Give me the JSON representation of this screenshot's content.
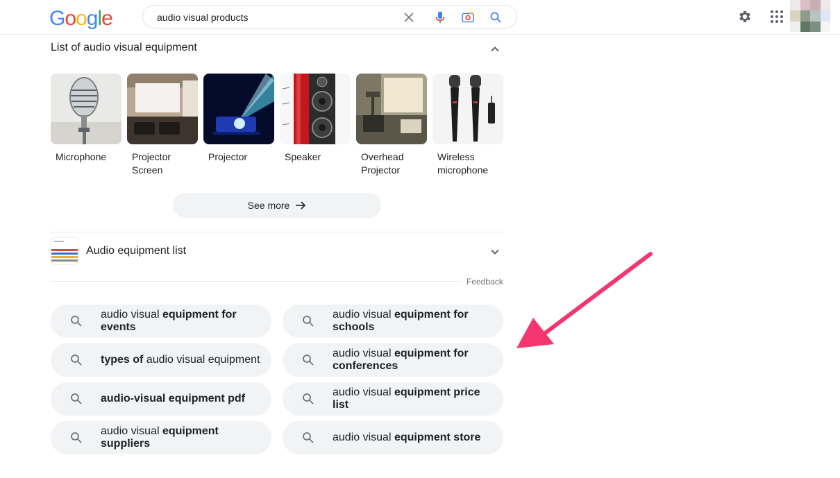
{
  "header": {
    "logo_letters": [
      "G",
      "o",
      "o",
      "g",
      "l",
      "e"
    ],
    "search": {
      "query": "audio visual products"
    },
    "icons": [
      "close-icon",
      "microphone-icon",
      "camera-lens-icon",
      "search-icon",
      "gear-icon",
      "apps-grid-icon"
    ]
  },
  "av_equipment": {
    "title": "List of audio visual equipment",
    "items": [
      {
        "label": "Microphone"
      },
      {
        "label": "Projector Screen"
      },
      {
        "label": "Projector"
      },
      {
        "label": "Speaker"
      },
      {
        "label": "Overhead Projector"
      },
      {
        "label": "Wireless microphone"
      }
    ],
    "see_more_label": "See more"
  },
  "audio_list": {
    "title": "Audio equipment list"
  },
  "feedback_label": "Feedback",
  "related_searches": [
    {
      "plain_before": "audio visual ",
      "bold": "equipment for events",
      "plain_after": ""
    },
    {
      "plain_before": "audio visual ",
      "bold": "equipment for schools",
      "plain_after": ""
    },
    {
      "plain_before": "",
      "bold": "types of",
      "plain_after": " audio visual equipment"
    },
    {
      "plain_before": "audio visual ",
      "bold": "equipment for conferences",
      "plain_after": ""
    },
    {
      "plain_before": "",
      "bold": "audio-visual equipment pdf",
      "plain_after": ""
    },
    {
      "plain_before": "audio visual ",
      "bold": "equipment price list",
      "plain_after": ""
    },
    {
      "plain_before": "audio visual ",
      "bold": "equipment suppliers",
      "plain_after": ""
    },
    {
      "plain_before": "audio visual ",
      "bold": "equipment store",
      "plain_after": ""
    }
  ],
  "colors": {
    "chip_bg": "#f1f3f4",
    "annotation_arrow": "#f5356f"
  }
}
